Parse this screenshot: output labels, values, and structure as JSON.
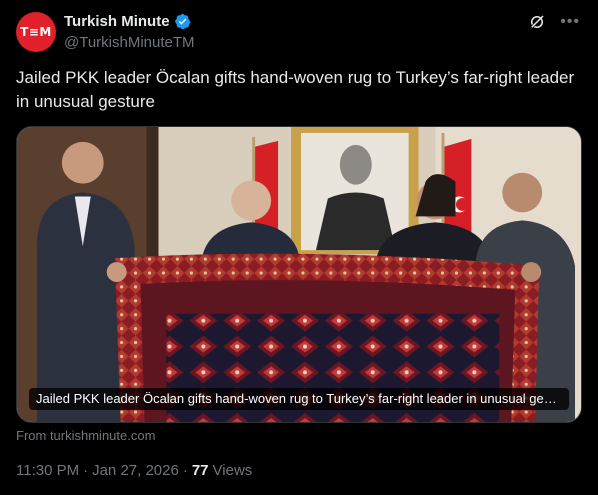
{
  "author": {
    "display_name": "Turkish Minute",
    "handle": "@TurkishMinuteTM",
    "avatar_text": "T≡M",
    "avatar_color": "#e0202a",
    "verified_color": "#1d9bf0"
  },
  "tweet": {
    "text": "Jailed PKK leader Öcalan gifts hand-woven rug to Turkey’s far-right leader in unusual gesture"
  },
  "card": {
    "caption": "Jailed PKK leader Öcalan gifts hand-woven rug to Turkey’s far-right leader in unusual gesture",
    "source": "From turkishminute.com"
  },
  "meta": {
    "time": "11:30 PM",
    "date": "Jan 27, 2026",
    "views_count": "77",
    "views_label": "Views"
  },
  "icons": {
    "grok": "grok-icon",
    "more": "more-icon",
    "verified": "verified-badge-icon"
  }
}
